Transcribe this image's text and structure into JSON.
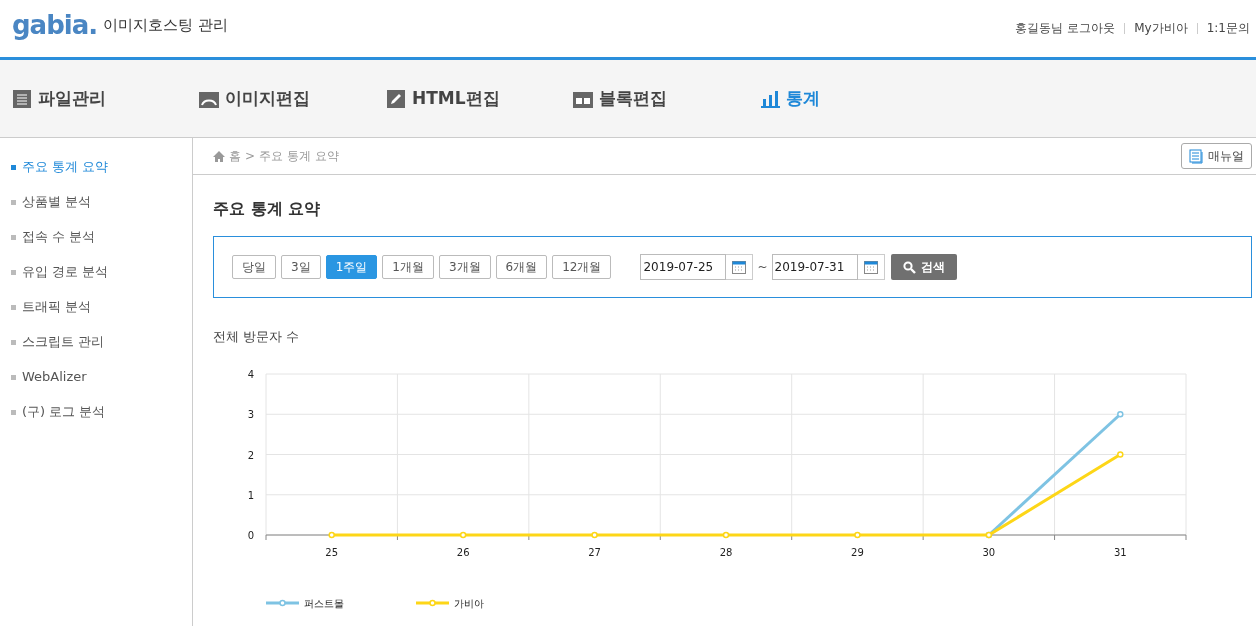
{
  "header": {
    "logo": "gabia.",
    "title": "이미지호스팅 관리",
    "links": [
      "홍길동님 로그아웃",
      "My가비아",
      "1:1문의"
    ]
  },
  "nav": [
    {
      "label": "파일관리",
      "kind": "list",
      "selected": false
    },
    {
      "label": "이미지편집",
      "kind": "image",
      "selected": false
    },
    {
      "label": "HTML편집",
      "kind": "pencil",
      "selected": false
    },
    {
      "label": "블록편집",
      "kind": "blocks",
      "selected": false
    },
    {
      "label": "통계",
      "kind": "chart",
      "selected": true
    }
  ],
  "sidebar": {
    "items": [
      {
        "label": "주요 통계 요약",
        "selected": true
      },
      {
        "label": "상품별 분석",
        "selected": false
      },
      {
        "label": "접속 수 분석",
        "selected": false
      },
      {
        "label": "유입 경로 분석",
        "selected": false
      },
      {
        "label": "트래픽 분석",
        "selected": false
      },
      {
        "label": "스크립트 관리",
        "selected": false
      },
      {
        "label": "WebAlizer",
        "selected": false
      },
      {
        "label": "(구) 로그 분석",
        "selected": false
      }
    ]
  },
  "breadcrumb": {
    "home": "홈",
    "separator": ">",
    "current": "주요 통계 요약"
  },
  "manual_button": "매뉴얼",
  "page_title": "주요 통계 요약",
  "filter": {
    "periods": [
      {
        "label": "당일",
        "selected": false
      },
      {
        "label": "3일",
        "selected": false
      },
      {
        "label": "1주일",
        "selected": true
      },
      {
        "label": "1개월",
        "selected": false
      },
      {
        "label": "3개월",
        "selected": false
      },
      {
        "label": "6개월",
        "selected": false
      },
      {
        "label": "12개월",
        "selected": false
      }
    ],
    "start_date": "2019-07-25",
    "tilde": "~",
    "end_date": "2019-07-31",
    "search_button": "검색"
  },
  "chart_section": {
    "title": "전체 방문자 수",
    "chart_data": {
      "type": "line",
      "categories": [
        "25",
        "26",
        "27",
        "28",
        "29",
        "30",
        "31"
      ],
      "ylim": [
        0,
        4
      ],
      "yticks": [
        0,
        1,
        2,
        3,
        4
      ],
      "grid": true,
      "legend": true,
      "series": [
        {
          "name": "퍼스트몰",
          "color": "#7ec3e3",
          "marker": "circle",
          "values": [
            null,
            null,
            null,
            null,
            null,
            0,
            3
          ]
        },
        {
          "name": "가비아",
          "color": "#fdd617",
          "marker": "circle",
          "values": [
            0,
            0,
            0,
            0,
            0,
            0,
            2
          ]
        }
      ]
    }
  }
}
